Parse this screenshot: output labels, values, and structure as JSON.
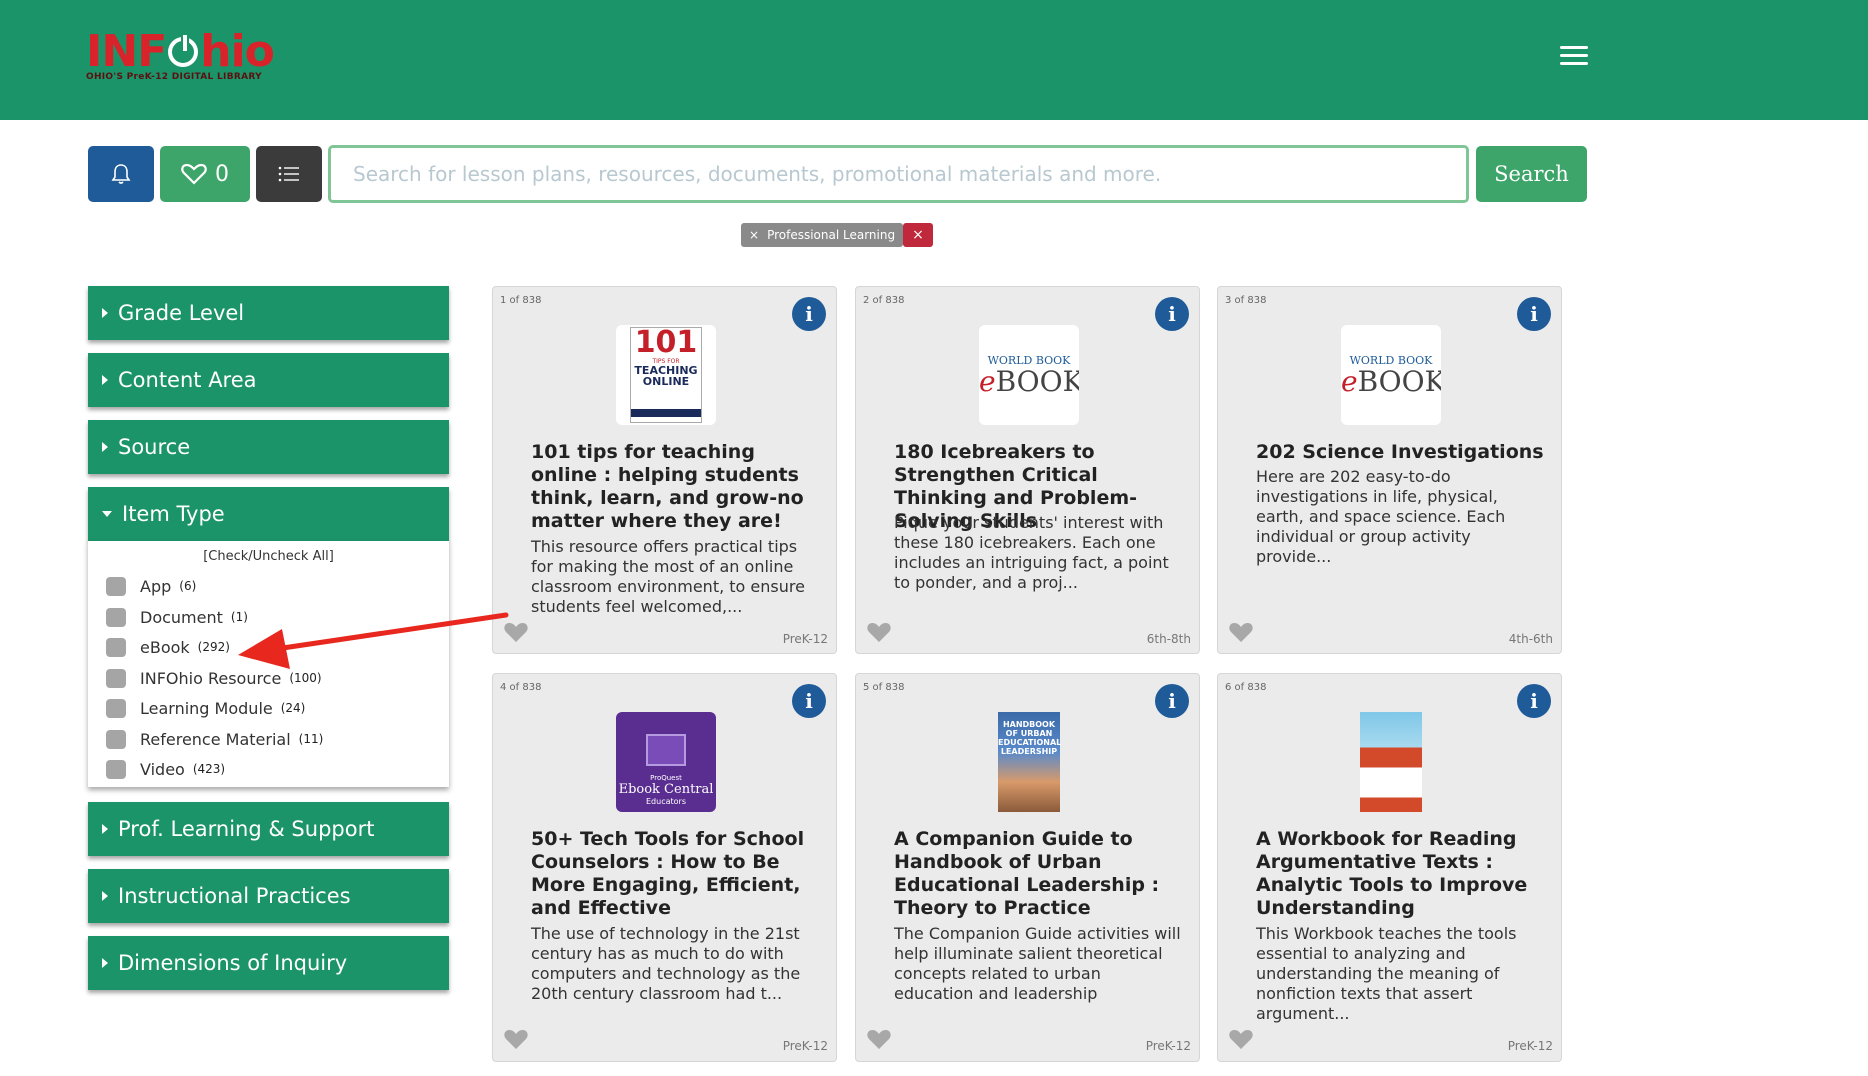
{
  "header": {
    "logo_text_left": "INF",
    "logo_text_right": "hio",
    "logo_tagline": "OHIO'S PreK-12 DIGITAL LIBRARY"
  },
  "toolbar": {
    "favorites_count": "0",
    "search_placeholder": "Search for lesson plans, resources, documents, promotional materials and more.",
    "search_value": "",
    "search_label": "Search"
  },
  "active_filter": {
    "label": "Professional Learning",
    "remove_glyph": "×",
    "clear_glyph": "×"
  },
  "sidebar": {
    "facets": [
      {
        "label": "Grade Level"
      },
      {
        "label": "Content Area"
      },
      {
        "label": "Source"
      },
      {
        "label": "Item Type"
      },
      {
        "label": "Prof. Learning & Support"
      },
      {
        "label": "Instructional Practices"
      },
      {
        "label": "Dimensions of Inquiry"
      }
    ],
    "item_type": {
      "check_all": "[Check/Uncheck All]",
      "options": [
        {
          "label": "App",
          "count": "(6)"
        },
        {
          "label": "Document",
          "count": "(1)"
        },
        {
          "label": "eBook",
          "count": "(292)"
        },
        {
          "label": "INFOhio Resource",
          "count": "(100)"
        },
        {
          "label": "Learning Module",
          "count": "(24)"
        },
        {
          "label": "Reference Material",
          "count": "(11)"
        },
        {
          "label": "Video",
          "count": "(423)"
        }
      ]
    }
  },
  "results": [
    {
      "count": "1 of 838",
      "title": "101 tips for teaching online : helping students think, learn, and grow-no matter where they are!",
      "description": "This resource offers practical tips for making the most of an online classroom environment, to ensure students feel welcomed,...",
      "grade": "PreK-12",
      "thumb": {
        "big": "101",
        "small": "TIPS FOR",
        "mid": "TEACHING ONLINE"
      }
    },
    {
      "count": "2 of 838",
      "title": "180 Icebreakers to Strengthen Critical Thinking and Problem-Solving Skills",
      "description": "Pique your students' interest with these 180 icebreakers. Each one includes an intriguing fact, a point to ponder, and a proj...",
      "grade": "6th-8th",
      "thumb": {
        "top": "WORLD BOOK",
        "e": "e",
        "book": "BOOK"
      }
    },
    {
      "count": "3 of 838",
      "title": "202 Science Investigations",
      "description": "Here are 202 easy-to-do investigations in life, physical, earth, and space science. Each individual or group activity provide...",
      "grade": "4th-6th",
      "thumb": {
        "top": "WORLD BOOK",
        "e": "e",
        "book": "BOOK"
      }
    },
    {
      "count": "4 of 838",
      "title": "50+ Tech Tools for School Counselors : How to Be More Engaging, Efficient, and Effective",
      "description": "The use of technology in the 21st century has as much to do with computers and technology as the 20th century classroom had t...",
      "grade": "PreK-12",
      "thumb": {
        "l1": "ProQuest",
        "l2": "Ebook Central",
        "l3": "Educators"
      }
    },
    {
      "count": "5 of 838",
      "title": "A Companion Guide to Handbook of Urban Educational Leadership : Theory to Practice",
      "description": "The Companion Guide activities will help illuminate salient theoretical concepts related to urban education and leadership",
      "grade": "PreK-12",
      "thumb": {
        "text": "HANDBOOK OF URBAN EDUCATIONAL LEADERSHIP"
      }
    },
    {
      "count": "6 of 838",
      "title": "A Workbook for Reading Argumentative Texts : Analytic Tools to Improve Understanding",
      "description": "This Workbook teaches the tools essential to analyzing and understanding the meaning of nonfiction texts that assert argument...",
      "grade": "PreK-12",
      "thumb": {}
    }
  ],
  "colors": {
    "header_green": "#1c946a",
    "button_green": "#3ea56a",
    "bell_blue": "#1f5b99",
    "list_dark": "#3b3b3b",
    "chip_gray": "#8a8a8a",
    "clear_red": "#c0283c",
    "annotation_arrow": "#e8281f"
  }
}
